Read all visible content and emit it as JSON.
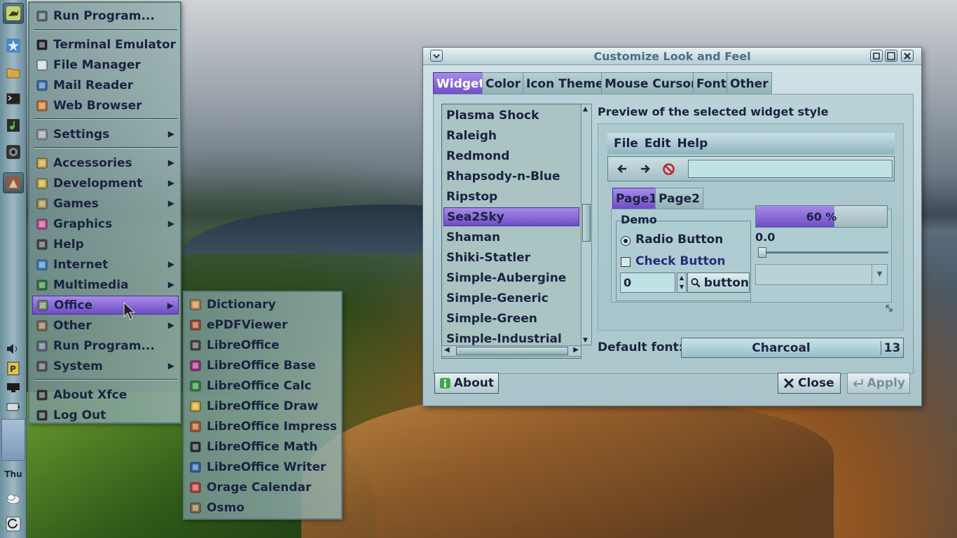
{
  "app_menu": {
    "items": [
      {
        "label": "Run Program...",
        "icon": "gear-icon"
      },
      {
        "label": "Terminal Emulator",
        "icon": "terminal-icon"
      },
      {
        "label": "File Manager",
        "icon": "file-manager-icon"
      },
      {
        "label": "Mail Reader",
        "icon": "mail-icon"
      },
      {
        "label": "Web Browser",
        "icon": "globe-icon"
      },
      {
        "label": "Settings",
        "icon": "settings-icon"
      },
      {
        "label": "Accessories",
        "icon": "accessories-icon"
      },
      {
        "label": "Development",
        "icon": "development-icon"
      },
      {
        "label": "Games",
        "icon": "games-icon"
      },
      {
        "label": "Graphics",
        "icon": "graphics-icon"
      },
      {
        "label": "Help",
        "icon": "help-icon"
      },
      {
        "label": "Internet",
        "icon": "internet-icon"
      },
      {
        "label": "Multimedia",
        "icon": "multimedia-icon"
      },
      {
        "label": "Office",
        "icon": "office-icon"
      },
      {
        "label": "Other",
        "icon": "other-icon"
      },
      {
        "label": "Run Program...",
        "icon": "gear-icon"
      },
      {
        "label": "System",
        "icon": "system-icon"
      },
      {
        "label": "About Xfce",
        "icon": "info-icon"
      },
      {
        "label": "Log Out",
        "icon": "logout-icon"
      }
    ],
    "selected": "Office"
  },
  "office_submenu": {
    "items": [
      {
        "label": "Dictionary",
        "icon": "dictionary-icon"
      },
      {
        "label": "ePDFViewer",
        "icon": "pdf-viewer-icon"
      },
      {
        "label": "LibreOffice",
        "icon": "libreoffice-icon"
      },
      {
        "label": "LibreOffice Base",
        "icon": "libreoffice-base-icon"
      },
      {
        "label": "LibreOffice Calc",
        "icon": "libreoffice-calc-icon"
      },
      {
        "label": "LibreOffice Draw",
        "icon": "libreoffice-draw-icon"
      },
      {
        "label": "LibreOffice Impress",
        "icon": "libreoffice-impress-icon"
      },
      {
        "label": "LibreOffice Math",
        "icon": "libreoffice-math-icon"
      },
      {
        "label": "LibreOffice Writer",
        "icon": "libreoffice-writer-icon"
      },
      {
        "label": "Orage Calendar",
        "icon": "calendar-icon"
      },
      {
        "label": "Osmo",
        "icon": "osmo-icon"
      }
    ]
  },
  "panel": {
    "day": "Thu"
  },
  "dialog": {
    "title": "Customize Look and Feel",
    "tabs": [
      "Widget",
      "Color",
      "Icon Theme",
      "Mouse Cursor",
      "Font",
      "Other"
    ],
    "active_tab": "Widget",
    "themes": [
      "Plasma Shock",
      "Raleigh",
      "Redmond",
      "Rhapsody-n-Blue",
      "Ripstop",
      "Sea2Sky",
      "Shaman",
      "Shiki-Statler",
      "Simple-Aubergine",
      "Simple-Generic",
      "Simple-Green",
      "Simple-Industrial"
    ],
    "selected_theme": "Sea2Sky",
    "preview_label": "Preview of the selected widget style",
    "preview": {
      "menu": [
        "File",
        "Edit",
        "Help"
      ],
      "tabs": [
        "Page1",
        "Page2"
      ],
      "demo_label": "Demo",
      "radio_label": "Radio Button",
      "check_label": "Check Button",
      "spin_value": "0",
      "button_label": "button",
      "progress_text": "60 %",
      "progress_value": 0.6,
      "scale_value": "0.0"
    },
    "default_font_label": "Default font:",
    "font_name": "Charcoal",
    "font_size": "13",
    "about_label": "About",
    "close_label": "Close",
    "apply_label": "Apply"
  },
  "colors": {
    "accent": "#6f4cc6",
    "accent_light": "#a78be8"
  }
}
